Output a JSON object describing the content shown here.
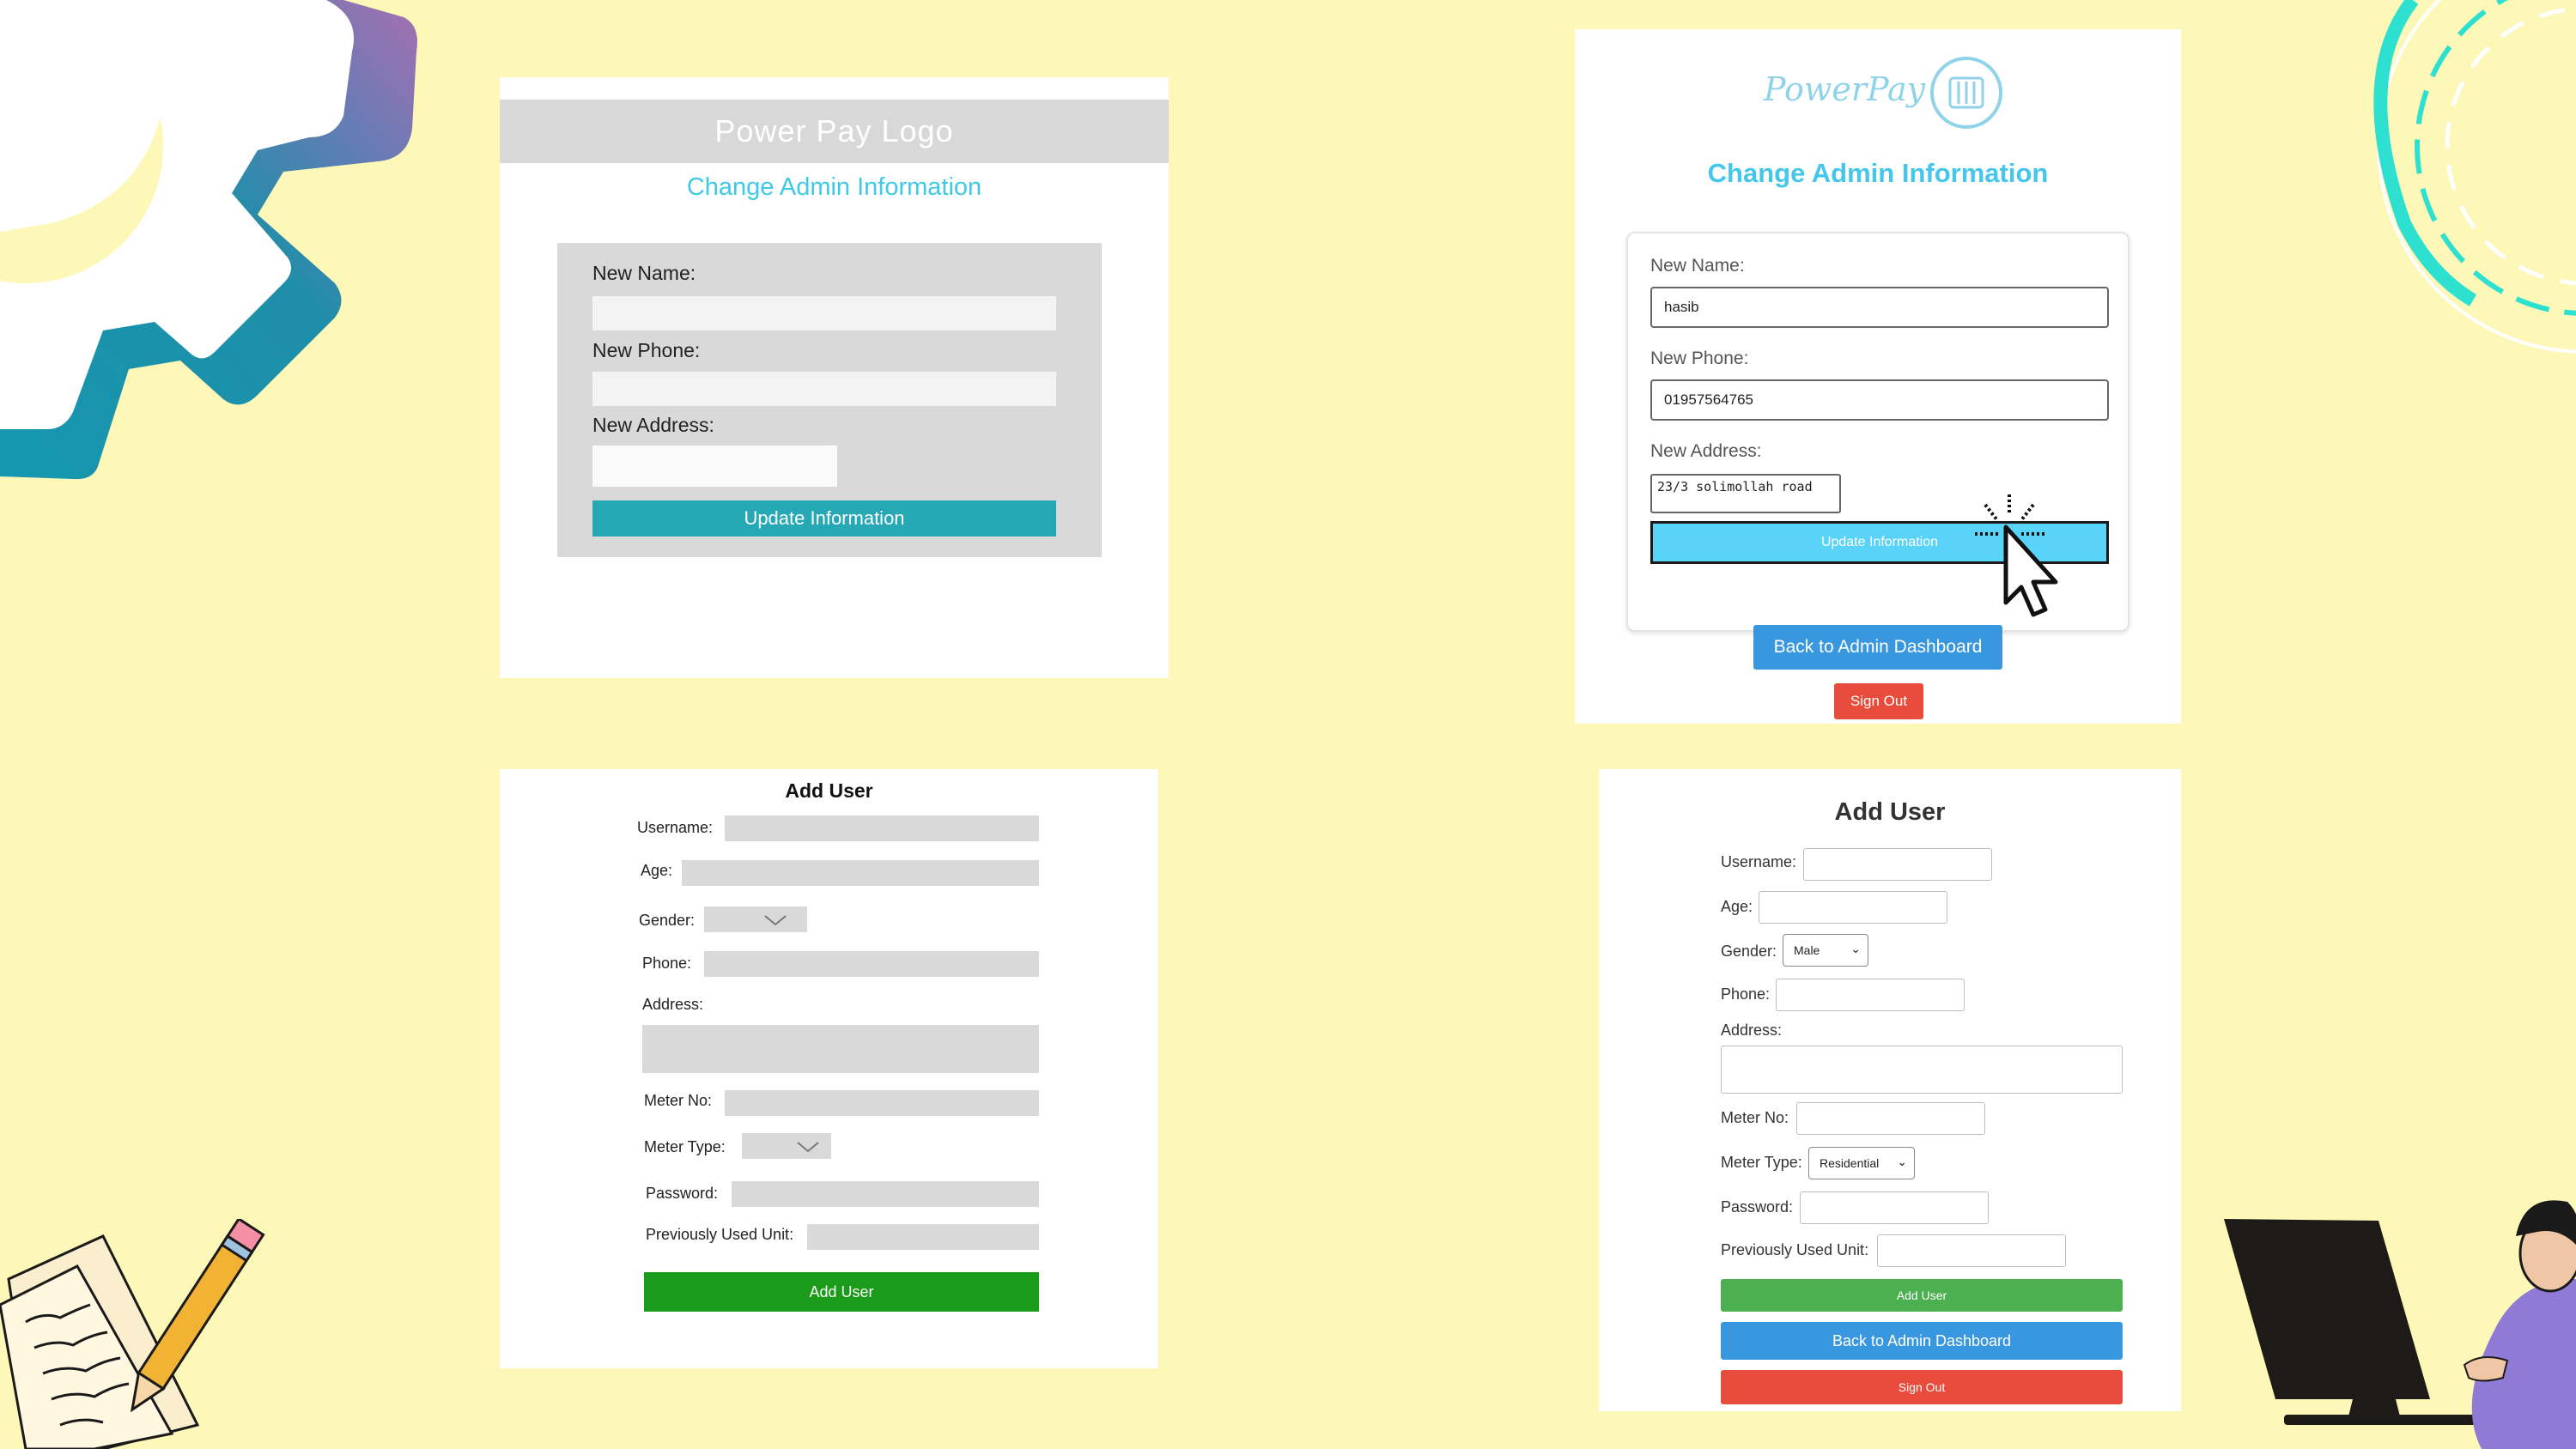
{
  "colors": {
    "background": "#fdf8b8",
    "wireframe_button": "#26a8b5",
    "primary_blue": "#3897df",
    "light_blue_button": "#5ad3f8",
    "danger_red": "#e74c3c",
    "success_green": "#4caf50",
    "wireframe_green": "#1a9b1a"
  },
  "wireframe_change_admin": {
    "logo_text": "Power Pay Logo",
    "title": "Change Admin Information",
    "name_label": "New Name:",
    "phone_label": "New Phone:",
    "address_label": "New Address:",
    "update_button": "Update Information"
  },
  "final_change_admin": {
    "brand_text": "PowerPay",
    "title": "Change Admin Information",
    "name_label": "New Name:",
    "name_value": "hasib",
    "phone_label": "New Phone:",
    "phone_value": "01957564765",
    "address_label": "New Address:",
    "address_value": "23/3 solimollah road",
    "update_button": "Update Information",
    "back_button": "Back to Admin Dashboard",
    "signout_button": "Sign Out"
  },
  "wireframe_add_user": {
    "title": "Add User",
    "username_label": "Username:",
    "age_label": "Age:",
    "gender_label": "Gender:",
    "phone_label": "Phone:",
    "address_label": "Address:",
    "meter_no_label": "Meter No:",
    "meter_type_label": "Meter Type:",
    "password_label": "Password:",
    "prev_unit_label": "Previously Used Unit:",
    "add_button": "Add User"
  },
  "final_add_user": {
    "title": "Add User",
    "username_label": "Username:",
    "age_label": "Age:",
    "gender_label": "Gender:",
    "gender_value": "Male",
    "phone_label": "Phone:",
    "address_label": "Address:",
    "meter_no_label": "Meter No:",
    "meter_type_label": "Meter Type:",
    "meter_type_value": "Residential",
    "password_label": "Password:",
    "prev_unit_label": "Previously Used Unit:",
    "add_button": "Add User",
    "back_button": "Back to Admin Dashboard",
    "signout_button": "Sign Out"
  },
  "icons": [
    "gear-decoration",
    "dashed-circle-decoration",
    "notes-pencil-illustration",
    "person-computer-illustration",
    "cursor-click-icon",
    "meter-logo-icon",
    "chevron-down-icon"
  ]
}
